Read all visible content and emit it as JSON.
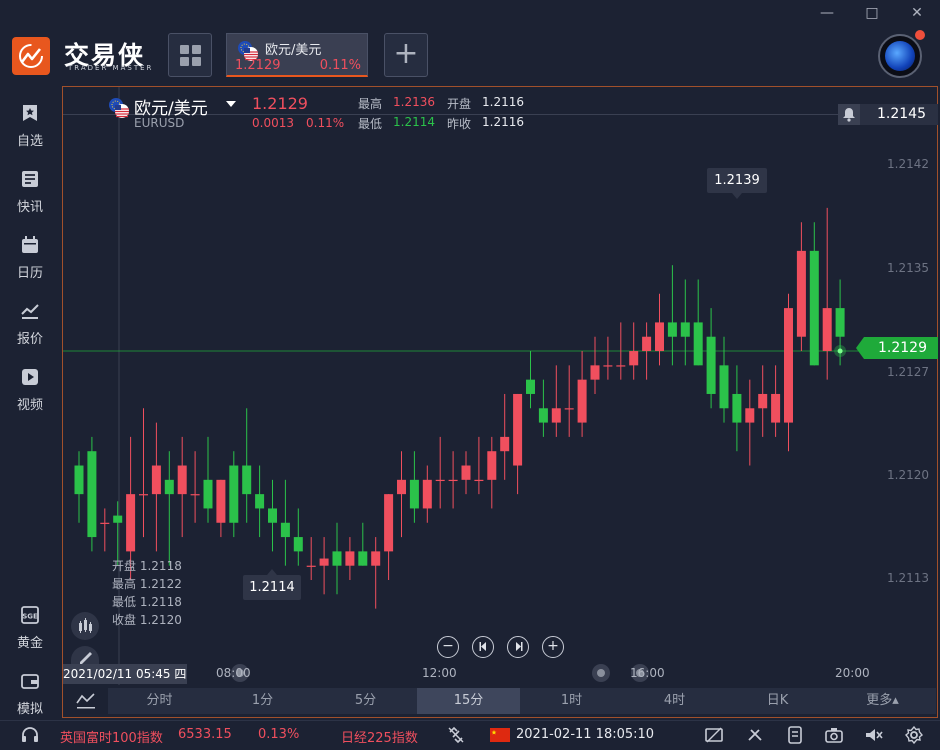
{
  "window": {
    "minimize": "—",
    "maximize": "□",
    "close": "✕"
  },
  "brand": {
    "name": "交易侠",
    "subtitle": "TRADER MASTER"
  },
  "tab": {
    "name": "欧元/美元",
    "price": "1.2129",
    "pct": "0.11%"
  },
  "sidebar": [
    {
      "label": "自选",
      "icon": "star-bookmark-icon"
    },
    {
      "label": "快讯",
      "icon": "news-icon"
    },
    {
      "label": "日历",
      "icon": "calendar-icon"
    },
    {
      "label": "报价",
      "icon": "quote-chart-icon"
    },
    {
      "label": "视频",
      "icon": "video-icon"
    },
    {
      "label": "黄金",
      "icon": "gold-exchange-icon"
    },
    {
      "label": "模拟",
      "icon": "wallet-icon"
    }
  ],
  "header": {
    "name": "欧元/美元",
    "code": "EURUSD",
    "price": "1.2129",
    "change": "0.0013",
    "change_pct": "0.11%",
    "high_label": "最高",
    "high": "1.2136",
    "low_label": "最低",
    "low": "1.2114",
    "open_label": "开盘",
    "open": "1.2116",
    "prev_label": "昨收",
    "prev": "1.2116"
  },
  "chart_data": {
    "type": "candlestick",
    "y_ticks": [
      "1.2145",
      "1.2142",
      "1.2135",
      "1.2127",
      "1.2120",
      "1.2113"
    ],
    "x_ticks": [
      "08:00",
      "12:00",
      "16:00",
      "20:00"
    ],
    "last_price": "1.2129",
    "alert_price": "1.2145",
    "max_label": "1.2139",
    "min_label": "1.2114",
    "crosshair_time": "2021/02/11 05:45 四",
    "crosshair_ohlc": [
      {
        "label": "开盘",
        "value": "1.2118"
      },
      {
        "label": "最高",
        "value": "1.2122"
      },
      {
        "label": "最低",
        "value": "1.2118"
      },
      {
        "label": "收盘",
        "value": "1.2120"
      }
    ],
    "candles": [
      [
        1.2121,
        1.2122,
        1.2117,
        1.2119
      ],
      [
        1.2122,
        1.2123,
        1.2115,
        1.2116
      ],
      [
        1.2117,
        1.2118,
        1.2115,
        1.2117
      ],
      [
        1.21175,
        1.21185,
        1.2114,
        1.2117
      ],
      [
        1.2115,
        1.2123,
        1.2113,
        1.2119
      ],
      [
        1.2119,
        1.2125,
        1.2116,
        1.2119
      ],
      [
        1.2119,
        1.2124,
        1.2115,
        1.2121
      ],
      [
        1.212,
        1.2122,
        1.2114,
        1.2119
      ],
      [
        1.2119,
        1.2123,
        1.2116,
        1.2121
      ],
      [
        1.2119,
        1.2122,
        1.2117,
        1.2119
      ],
      [
        1.212,
        1.2123,
        1.2117,
        1.2118
      ],
      [
        1.2117,
        1.212,
        1.2116,
        1.212
      ],
      [
        1.2121,
        1.2122,
        1.2116,
        1.2117
      ],
      [
        1.2121,
        1.2125,
        1.2117,
        1.2119
      ],
      [
        1.2119,
        1.2121,
        1.2116,
        1.2118
      ],
      [
        1.2118,
        1.212,
        1.2115,
        1.2117
      ],
      [
        1.2117,
        1.212,
        1.2114,
        1.2116
      ],
      [
        1.2116,
        1.2118,
        1.2114,
        1.2115
      ],
      [
        1.2114,
        1.2116,
        1.2113,
        1.2114
      ],
      [
        1.2114,
        1.2116,
        1.2112,
        1.21145
      ],
      [
        1.2115,
        1.2117,
        1.2112,
        1.2114
      ],
      [
        1.2114,
        1.2116,
        1.2113,
        1.2115
      ],
      [
        1.2115,
        1.2117,
        1.2114,
        1.2114
      ],
      [
        1.2114,
        1.2116,
        1.2111,
        1.2115
      ],
      [
        1.2115,
        1.2119,
        1.2113,
        1.2119
      ],
      [
        1.2119,
        1.2122,
        1.2116,
        1.212
      ],
      [
        1.212,
        1.2122,
        1.2117,
        1.2118
      ],
      [
        1.2118,
        1.2121,
        1.2117,
        1.212
      ],
      [
        1.212,
        1.2123,
        1.2118,
        1.212
      ],
      [
        1.212,
        1.2122,
        1.2118,
        1.212
      ],
      [
        1.212,
        1.2122,
        1.2119,
        1.2121
      ],
      [
        1.212,
        1.2123,
        1.2119,
        1.212
      ],
      [
        1.212,
        1.2123,
        1.2118,
        1.2122
      ],
      [
        1.2122,
        1.2126,
        1.212,
        1.2123
      ],
      [
        1.2121,
        1.2126,
        1.2119,
        1.2126
      ],
      [
        1.2127,
        1.2129,
        1.2125,
        1.2126
      ],
      [
        1.2125,
        1.2127,
        1.2123,
        1.2124
      ],
      [
        1.2124,
        1.2128,
        1.2123,
        1.2125
      ],
      [
        1.2125,
        1.2128,
        1.2123,
        1.2125
      ],
      [
        1.2124,
        1.2129,
        1.2123,
        1.2127
      ],
      [
        1.2127,
        1.213,
        1.2126,
        1.2128
      ],
      [
        1.2128,
        1.213,
        1.2127,
        1.2128
      ],
      [
        1.2128,
        1.2131,
        1.2127,
        1.2128
      ],
      [
        1.2128,
        1.2131,
        1.2127,
        1.2129
      ],
      [
        1.2129,
        1.2131,
        1.2127,
        1.213
      ],
      [
        1.2129,
        1.2133,
        1.2128,
        1.2131
      ],
      [
        1.2131,
        1.2135,
        1.2128,
        1.213
      ],
      [
        1.2131,
        1.2134,
        1.2128,
        1.213
      ],
      [
        1.2131,
        1.2134,
        1.2128,
        1.2128
      ],
      [
        1.213,
        1.2132,
        1.2125,
        1.2126
      ],
      [
        1.2128,
        1.213,
        1.2124,
        1.2125
      ],
      [
        1.2126,
        1.2128,
        1.2122,
        1.2124
      ],
      [
        1.2124,
        1.2127,
        1.2121,
        1.2125
      ],
      [
        1.2125,
        1.2128,
        1.2123,
        1.2126
      ],
      [
        1.2124,
        1.2128,
        1.2123,
        1.2126
      ],
      [
        1.2124,
        1.2133,
        1.2122,
        1.2132
      ],
      [
        1.213,
        1.2138,
        1.2129,
        1.2136
      ],
      [
        1.2136,
        1.2138,
        1.2128,
        1.2128
      ],
      [
        1.2129,
        1.2139,
        1.2127,
        1.2132
      ],
      [
        1.2132,
        1.2134,
        1.2128,
        1.213
      ]
    ]
  },
  "nav": {
    "prev": "−",
    "first": "⏮",
    "last": "⏭",
    "zoom_in": "+"
  },
  "periods": [
    "分时",
    "1分",
    "5分",
    "15分",
    "1时",
    "4时",
    "日K",
    "更多▴"
  ],
  "active_period": "15分",
  "status": {
    "index1_name": "英国富时100指数",
    "index1_value": "6533.15",
    "index1_pct": "0.13%",
    "index2_name": "日经225指数",
    "datetime": "2021-02-11 18:05:10"
  }
}
